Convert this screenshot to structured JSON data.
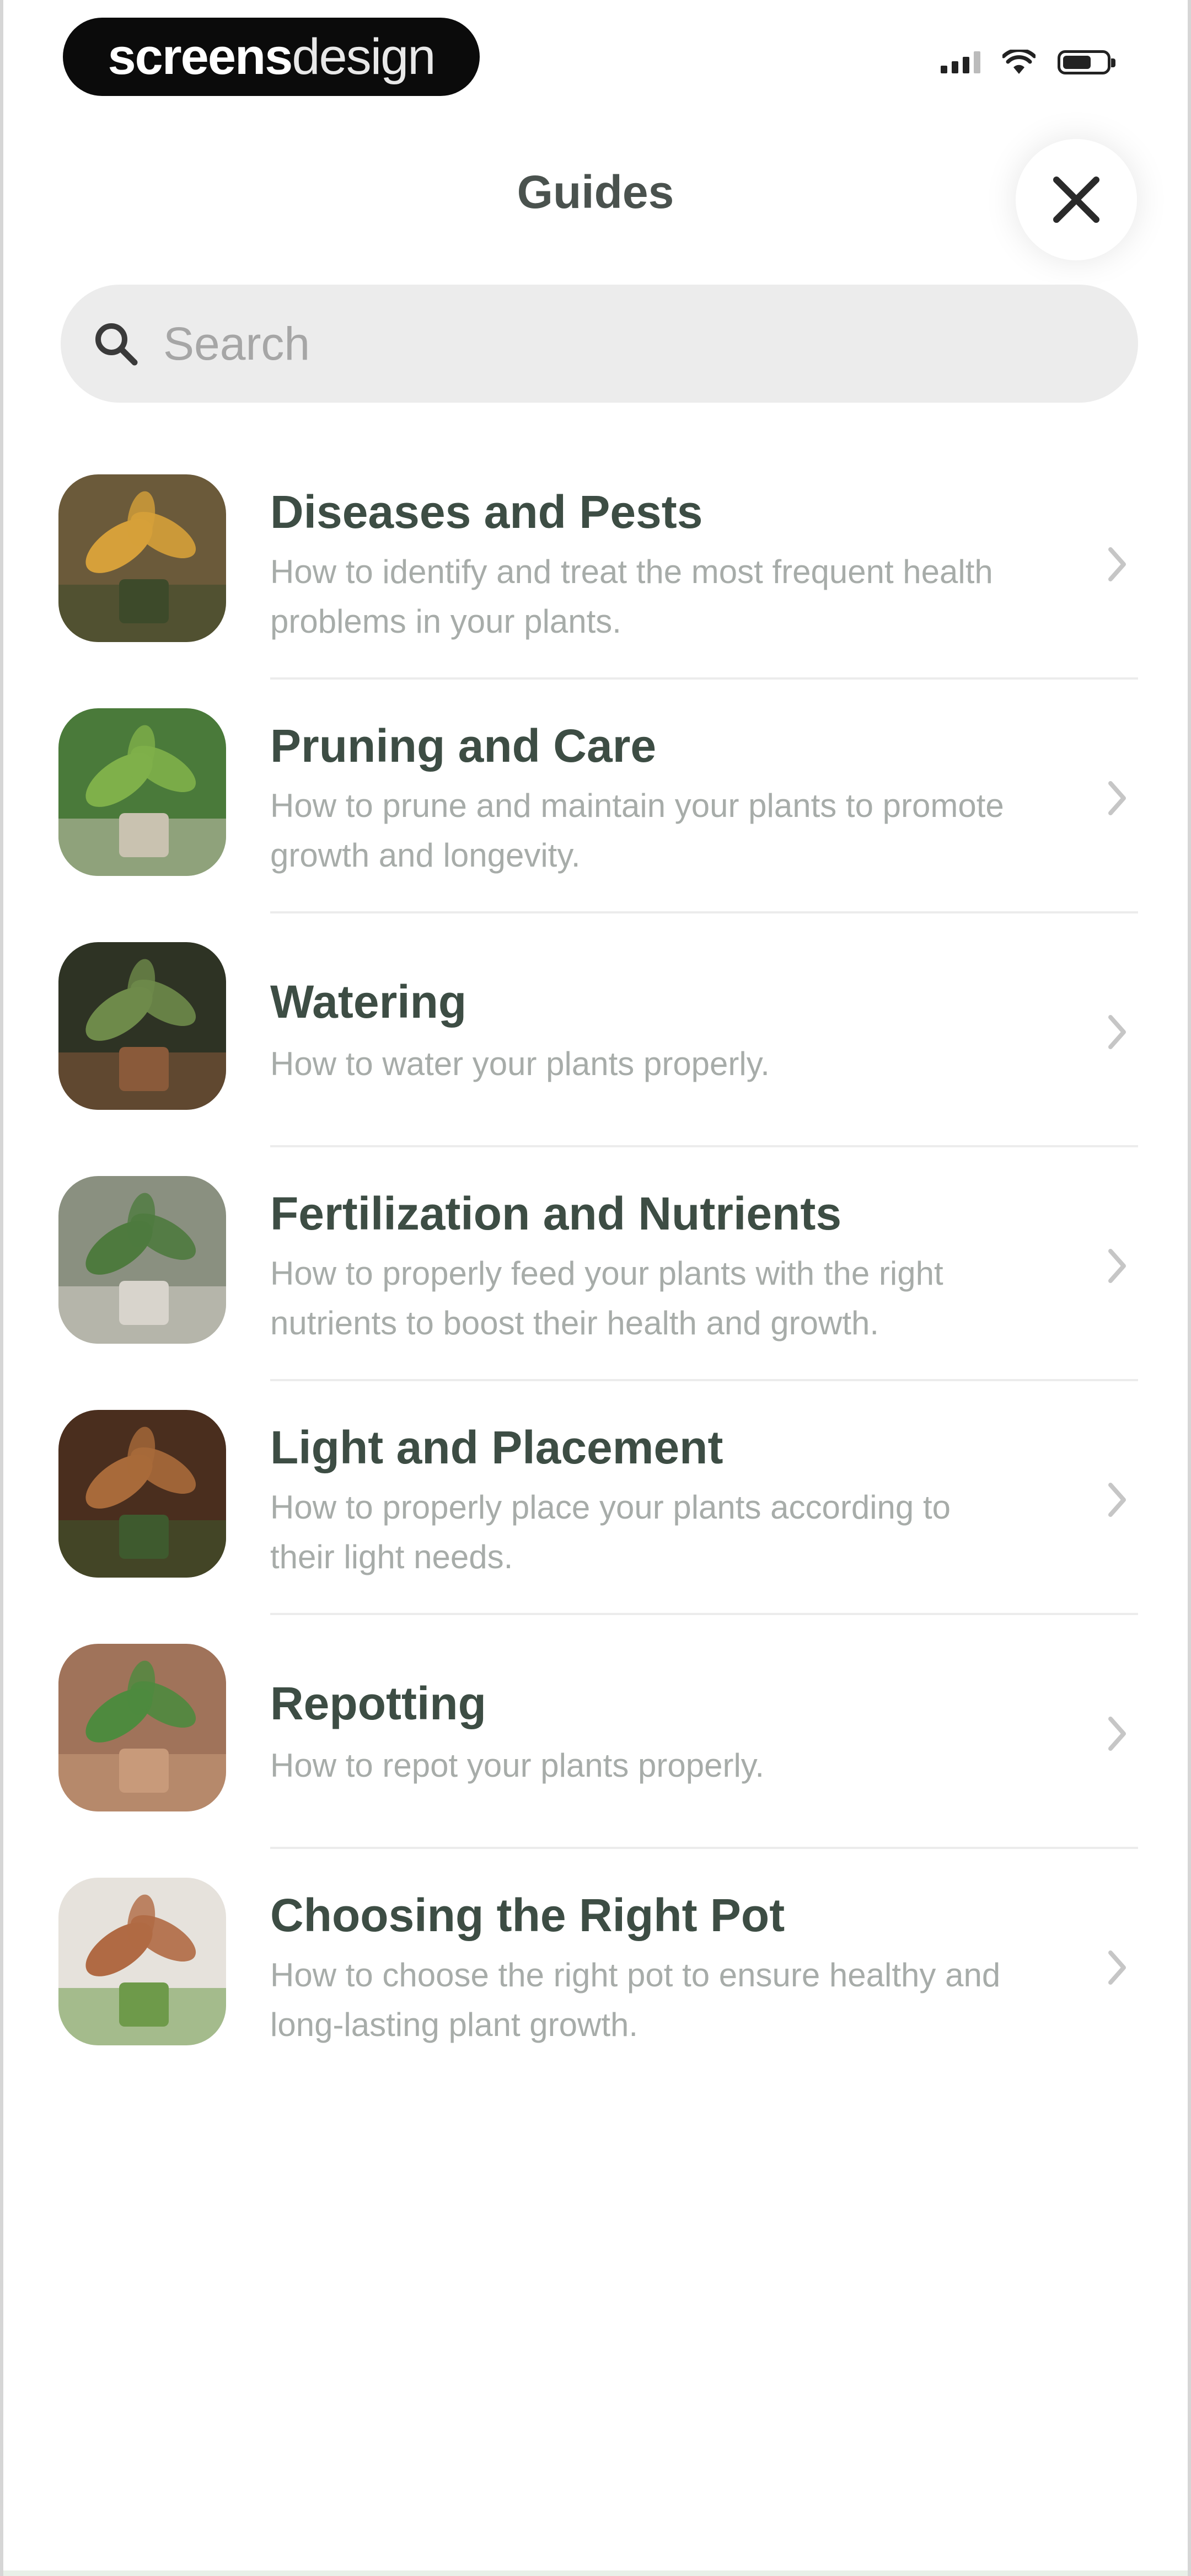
{
  "status_bar": {
    "brand_bold": "screens",
    "brand_light": "design",
    "icons": [
      "cellular-signal-icon",
      "wifi-icon",
      "battery-icon"
    ]
  },
  "header": {
    "title": "Guides",
    "close_icon": "close-icon"
  },
  "search": {
    "placeholder": "Search",
    "value": "",
    "icon": "search-icon"
  },
  "guides": [
    {
      "title": "Diseases and Pests",
      "description": "How to identify and treat the most frequent health problems in your plants.",
      "thumbnail": "diseased-plant-photo",
      "colors": [
        "#6b5a3a",
        "#d6a03a",
        "#3d4a2a"
      ]
    },
    {
      "title": "Pruning and Care",
      "description": "How to prune and maintain your plants to promote growth and longevity.",
      "thumbnail": "pruning-leaves-photo",
      "colors": [
        "#4a7a3a",
        "#7fb04a",
        "#c9c2b0"
      ]
    },
    {
      "title": "Watering",
      "description": "How to water your plants properly.",
      "thumbnail": "watering-can-photo",
      "colors": [
        "#2e3324",
        "#6e8a4a",
        "#8a5a3a"
      ]
    },
    {
      "title": "Fertilization and Nutrients",
      "description": "How to properly feed your plants with the right nutrients to boost their health and growth.",
      "thumbnail": "fertilizing-plant-photo",
      "colors": [
        "#8a9080",
        "#4e7a3e",
        "#d8d4cc"
      ]
    },
    {
      "title": "Light and Placement",
      "description": "How to properly place your plants according to their light needs.",
      "thumbnail": "plants-by-window-photo",
      "colors": [
        "#4a2e1e",
        "#a86a3a",
        "#3e5a2e"
      ]
    },
    {
      "title": "Repotting",
      "description": "How to repot your plants properly.",
      "thumbnail": "repotting-plant-photo",
      "colors": [
        "#a0735a",
        "#4e8a3e",
        "#c89a7a"
      ]
    },
    {
      "title": "Choosing the Right Pot",
      "description": "How to choose the right pot to ensure healthy and long-lasting plant growth.",
      "thumbnail": "plant-pots-photo",
      "colors": [
        "#e6e2dc",
        "#b06a44",
        "#6e9a4a"
      ]
    }
  ]
}
